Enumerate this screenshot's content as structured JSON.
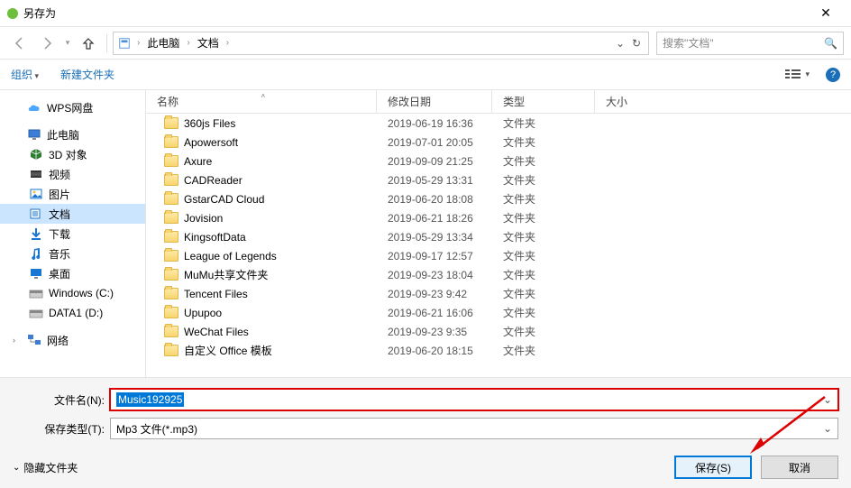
{
  "title": "另存为",
  "breadcrumb": {
    "root": "此电脑",
    "folder": "文档"
  },
  "search": {
    "placeholder": "搜索\"文档\""
  },
  "toolbar": {
    "organize": "组织",
    "newfolder": "新建文件夹"
  },
  "columns": {
    "name": "名称",
    "date": "修改日期",
    "type": "类型",
    "size": "大小"
  },
  "sidebar": {
    "wps": "WPS网盘",
    "thispc": "此电脑",
    "items": [
      {
        "label": "3D 对象",
        "color": "#2e7d32"
      },
      {
        "label": "视频",
        "color": "#555"
      },
      {
        "label": "图片",
        "color": "#1976d2"
      },
      {
        "label": "文档",
        "color": "#1976d2",
        "selected": true
      },
      {
        "label": "下载",
        "color": "#1976d2"
      },
      {
        "label": "音乐",
        "color": "#1976d2"
      },
      {
        "label": "桌面",
        "color": "#1976d2"
      },
      {
        "label": "Windows (C:)",
        "color": "#888"
      },
      {
        "label": "DATA1 (D:)",
        "color": "#888"
      }
    ],
    "network": "网络"
  },
  "files": [
    {
      "name": "360js Files",
      "date": "2019-06-19 16:36",
      "type": "文件夹"
    },
    {
      "name": "Apowersoft",
      "date": "2019-07-01 20:05",
      "type": "文件夹"
    },
    {
      "name": "Axure",
      "date": "2019-09-09 21:25",
      "type": "文件夹"
    },
    {
      "name": "CADReader",
      "date": "2019-05-29 13:31",
      "type": "文件夹"
    },
    {
      "name": "GstarCAD Cloud",
      "date": "2019-06-20 18:08",
      "type": "文件夹"
    },
    {
      "name": "Jovision",
      "date": "2019-06-21 18:26",
      "type": "文件夹"
    },
    {
      "name": "KingsoftData",
      "date": "2019-05-29 13:34",
      "type": "文件夹"
    },
    {
      "name": "League of Legends",
      "date": "2019-09-17 12:57",
      "type": "文件夹"
    },
    {
      "name": "MuMu共享文件夹",
      "date": "2019-09-23 18:04",
      "type": "文件夹"
    },
    {
      "name": "Tencent Files",
      "date": "2019-09-23 9:42",
      "type": "文件夹"
    },
    {
      "name": "Upupoo",
      "date": "2019-06-21 16:06",
      "type": "文件夹"
    },
    {
      "name": "WeChat Files",
      "date": "2019-09-23 9:35",
      "type": "文件夹"
    },
    {
      "name": "自定义 Office 模板",
      "date": "2019-06-20 18:15",
      "type": "文件夹"
    }
  ],
  "footer": {
    "filename_label": "文件名(N):",
    "filename_value": "Music192925",
    "filetype_label": "保存类型(T):",
    "filetype_value": "Mp3 文件(*.mp3)",
    "hide_folders": "隐藏文件夹",
    "save": "保存(S)",
    "cancel": "取消"
  }
}
